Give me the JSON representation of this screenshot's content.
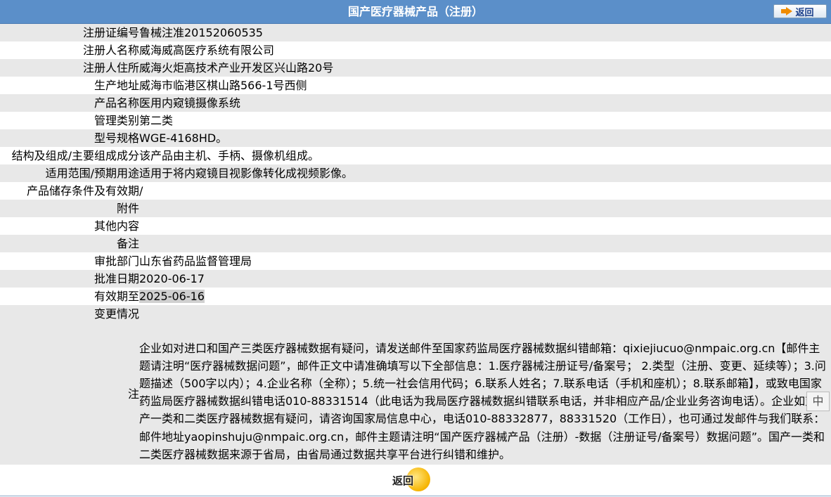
{
  "header": {
    "title": "国产医疗器械产品（注册）",
    "back_label": "返回"
  },
  "rows": [
    {
      "key": "注册证编号",
      "value": "鲁械注准20152060535"
    },
    {
      "key": "注册人名称",
      "value": "威海威高医疗系统有限公司"
    },
    {
      "key": "注册人住所",
      "value": "威海火炬高技术产业开发区兴山路20号"
    },
    {
      "key": "生产地址",
      "value": "威海市临港区棋山路566-1号西侧"
    },
    {
      "key": "产品名称",
      "value": "医用内窥镜摄像系统"
    },
    {
      "key": "管理类别",
      "value": "第二类"
    },
    {
      "key": "型号规格",
      "value": "WGE-4168HD。"
    },
    {
      "key": "结构及组成/主要组成成分",
      "value": "该产品由主机、手柄、摄像机组成。"
    },
    {
      "key": "适用范围/预期用途",
      "value": "适用于将内窥镜目视影像转化成视频影像。"
    },
    {
      "key": "产品储存条件及有效期",
      "value": "/"
    },
    {
      "key": "附件",
      "value": ""
    },
    {
      "key": "其他内容",
      "value": ""
    },
    {
      "key": "备注",
      "value": ""
    },
    {
      "key": "审批部门",
      "value": "山东省药品监督管理局"
    },
    {
      "key": "批准日期",
      "value": "2020-06-17"
    },
    {
      "key": "有效期至",
      "value": "2025-06-16"
    },
    {
      "key": "变更情况",
      "value": ""
    }
  ],
  "note": {
    "key": "注",
    "text": "企业如对进口和国产三类医疗器械数据有疑问，请发送邮件至国家药监局医疗器械数据纠错邮箱：qixiejiucuo@nmpaic.org.cn【邮件主题请注明“医疗器械数据问题”，邮件正文中请准确填写以下全部信息：1.医疗器械注册证号/备案号； 2.类型（注册、变更、延续等）；3.问题描述（500字以内）；4.企业名称（全称）；5.统一社会信用代码；6.联系人姓名；7.联系电话（手机和座机）；8.联系邮箱】，或致电国家药监局医疗器械数据纠错电话010-88331514（此电话为我局医疗器械数据纠错联系电话，并非相应产品/企业业务咨询电话）。企业如对国产一类和二类医疗器械数据有疑问，请咨询国家局信息中心，电话010-88332877，88331520（工作日），也可通过发邮件与我们联系：邮件地址yaopinshuju@nmpaic.org.cn，邮件主题请注明“国产医疗器械产品（注册）-数据（注册证号/备案号）数据问题”。国产一类和二类医疗器械数据来源于省局，由省局通过数据共享平台进行纠错和维护。"
  },
  "footer": {
    "back_label": "返回"
  },
  "ime": {
    "label": "中"
  },
  "colors": {
    "header_bg": "#5b8fc9",
    "row_odd": "#e8e8e8",
    "row_even": "#ffffff",
    "accent": "#f08c00"
  }
}
